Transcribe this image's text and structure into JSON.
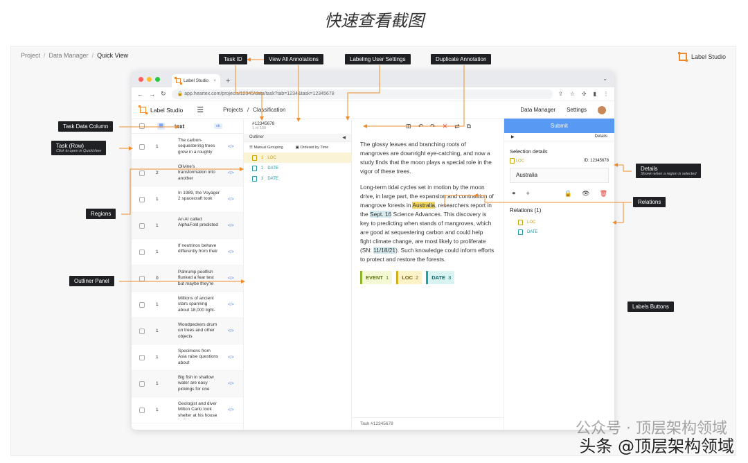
{
  "page_heading": "快速查看截图",
  "breadcrumb": [
    "Project",
    "Data Manager",
    "Quick View"
  ],
  "brand": "Label Studio",
  "browser": {
    "tab_title": "Label Studio",
    "url": "app.heartex.com/projects/12345/data/task?tab=1234&task=12345678"
  },
  "app": {
    "brand": "Label Studio",
    "nav_projects": "Projects",
    "nav_sep": "/",
    "nav_current": "Classification",
    "data_manager": "Data Manager",
    "settings": "Settings"
  },
  "task_table": {
    "column": "text",
    "type_badge": "str",
    "rows": [
      {
        "n": "1",
        "text": "The carbon-sequestering trees grow in a roughly"
      },
      {
        "n": "2",
        "text": "Olivine's transformation into another"
      },
      {
        "n": "1",
        "text": "In 1989, the Voyager 2 spacecraft took"
      },
      {
        "n": "1",
        "text": "An AI called AlphaFold predicted"
      },
      {
        "n": "1",
        "text": "If neutrinos behave differently from their"
      },
      {
        "n": "0",
        "text": "Pahrump poolfish flunked a fear test but maybe they're"
      },
      {
        "n": "1",
        "text": "Millions of ancient stars spanning about 18,000 light-"
      },
      {
        "n": "1",
        "text": "Woodpeckers drum on trees and other objects"
      },
      {
        "n": "1",
        "text": "Specimens from Asia raise questions about"
      },
      {
        "n": "1",
        "text": "Big fish in shallow water are easy pickings for one"
      },
      {
        "n": "1",
        "text": "Geologist and diver Milton Carlo took shelter at his house in Cabo"
      }
    ],
    "code_icon": "</>"
  },
  "outliner": {
    "task_id": "#12345678",
    "task_count": "1 of 100",
    "title": "Outliner",
    "group_manual": "Manual Grouping",
    "group_time": "Ordered by Time",
    "items": [
      {
        "idx": "1",
        "label": "LOC"
      },
      {
        "idx": "2",
        "label": "DATE"
      },
      {
        "idx": "3",
        "label": "DATE"
      }
    ]
  },
  "editor": {
    "para1": "The glossy leaves and branching roots of mangroves are downright eye-catching, and now a study finds that the moon plays a special role in the vigor of these trees.",
    "para2_a": "Long-term tidal cycles set in motion by the moon drive, in large part, the expansion and contraction of mangrove forests in ",
    "para2_loc": "Australia",
    "para2_b": ", researchers report in the ",
    "para2_date1": "Sept. 16",
    "para2_c": " Science Advances. This discovery is key to predicting when stands of mangroves, which are good at sequestering carbon and could help fight climate change, are most likely to proliferate (SN: ",
    "para2_date2": "11/18/21",
    "para2_d": "). Such knowledge could inform efforts to protect and restore the forests.",
    "labels": [
      {
        "name": "EVENT",
        "key": "1"
      },
      {
        "name": "LOC",
        "key": "2"
      },
      {
        "name": "DATE",
        "key": "3"
      }
    ],
    "footer": "Task #12345678"
  },
  "details": {
    "submit": "Submit",
    "header": "Details",
    "selection_title": "Selection details",
    "region_label": "LOC",
    "region_id": "ID: 12345678",
    "region_text": "Australia",
    "relations_title": "Relations (1)",
    "relations": [
      "LOC",
      "DATE"
    ]
  },
  "callouts": {
    "task_id": "Task ID",
    "view_all": "View All Annotations",
    "labeling_settings": "Labeling User Settings",
    "duplicate": "Duplicate Annotation",
    "task_data_column": "Task Data Column",
    "task_row": "Task (Row)",
    "task_row_sub": "Click to open in QuickView",
    "regions": "Regions",
    "outliner_panel": "Outliner Panel",
    "details": "Details",
    "details_sub": "Shown when a region is selected",
    "relations": "Relations",
    "labels_buttons": "Labels Buttons"
  },
  "watermark_grey": "公众号 · 顶层架构领域",
  "watermark_black": "头条 @顶层架构领域",
  "colors": {
    "accent": "#5799f3",
    "loc": "#d8ae17",
    "date": "#1ea3a9",
    "event": "#8fb629",
    "brand_orange": "#f28a2b"
  }
}
